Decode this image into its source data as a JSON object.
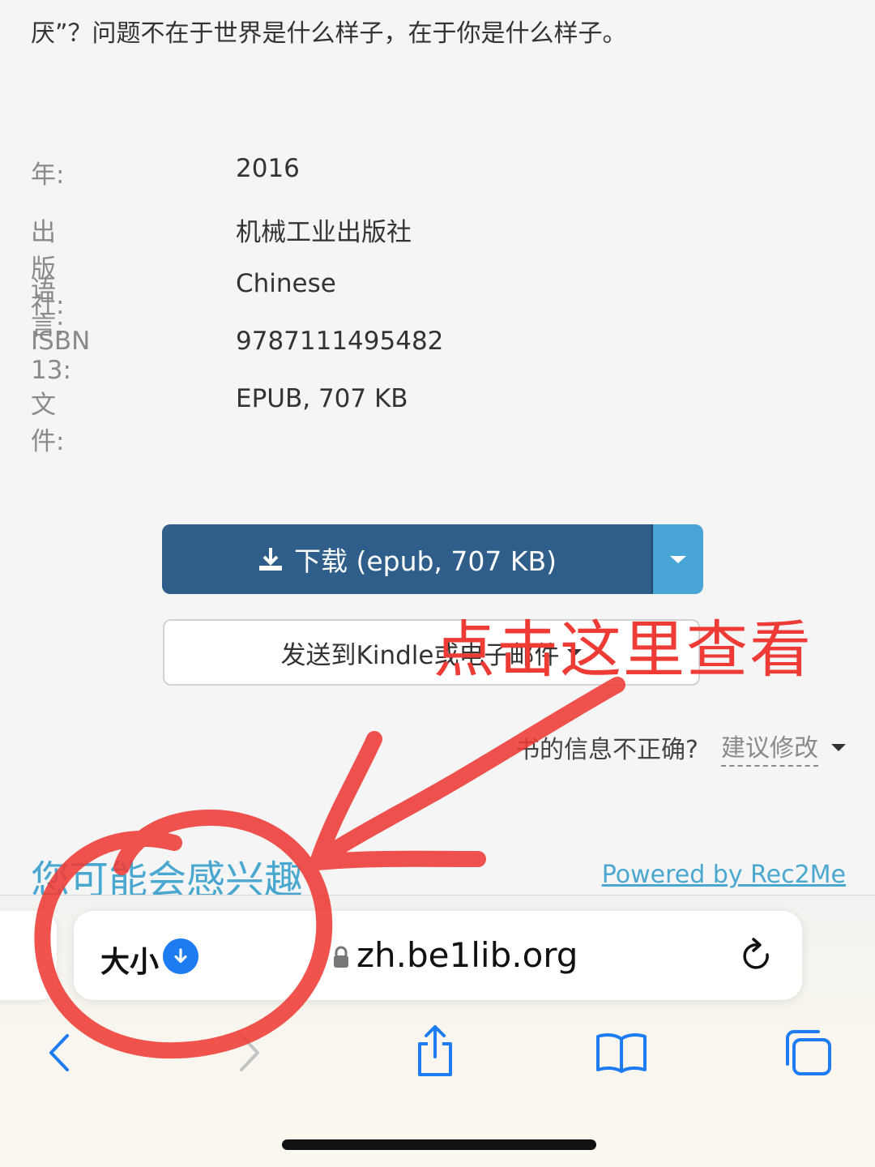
{
  "intro_text": "厌”？问题不在于世界是什么样子，在于你是什么样子。",
  "details": [
    {
      "label": "年:",
      "value": "2016"
    },
    {
      "label": "出版社:",
      "value": "机械工业出版社"
    },
    {
      "label": "语言:",
      "value": "Chinese"
    },
    {
      "label": "ISBN 13:",
      "value": "9787111495482"
    },
    {
      "label": "文件:",
      "value": "EPUB, 707 KB"
    }
  ],
  "download_button": {
    "label": "下载 (epub, 707 KB)",
    "icon": "download-icon"
  },
  "kindle_button": {
    "label": "发送到Kindle或电子邮件"
  },
  "correction": {
    "question": "书的信息不正确?",
    "link": "建议修改"
  },
  "related": {
    "heading": "您可能会感兴趣",
    "powered_by": "Powered by Rec2Me"
  },
  "browser": {
    "size_label": "大小",
    "url": "zh.be1lib.org",
    "accent_color": "#1d7cf2"
  },
  "annotation": {
    "text": "点击这里查看",
    "color": "#ee3b36"
  },
  "colors": {
    "primary_button": "#2f5e8a",
    "secondary_toggle": "#49a5d6",
    "link": "#4aa7cf"
  }
}
